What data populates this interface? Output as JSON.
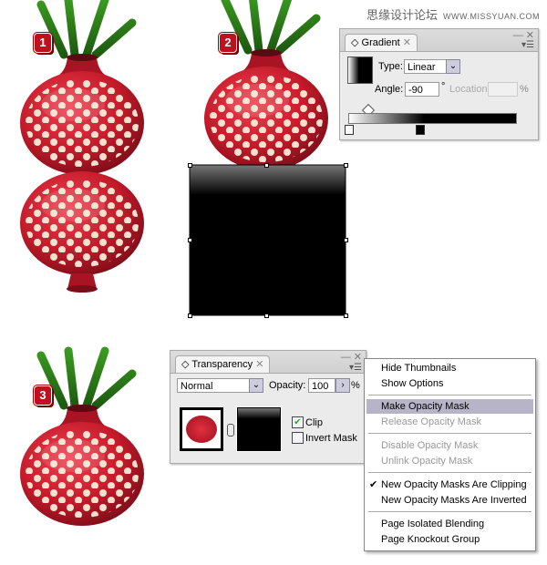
{
  "watermark": {
    "cn": "思缘设计论坛",
    "url": "WWW.MISSYUAN.COM"
  },
  "steps": [
    "1",
    "2",
    "3"
  ],
  "gradient_panel": {
    "tab": "Gradient",
    "type_label": "Type:",
    "type_value": "Linear",
    "angle_label": "Angle:",
    "angle_value": "-90",
    "degree": "°",
    "location_label": "Location:",
    "location_value": "",
    "percent": "%"
  },
  "transparency_panel": {
    "tab": "Transparency",
    "blend_mode": "Normal",
    "opacity_label": "Opacity:",
    "opacity_value": "100",
    "percent": "%",
    "clip_label": "Clip",
    "clip_checked": true,
    "invert_label": "Invert Mask",
    "invert_checked": false
  },
  "menu": {
    "items": [
      {
        "label": "Hide Thumbnails",
        "enabled": true
      },
      {
        "label": "Show Options",
        "enabled": true
      },
      {
        "label": "Make Opacity Mask",
        "enabled": true,
        "highlighted": true
      },
      {
        "label": "Release Opacity Mask",
        "enabled": false
      },
      {
        "label": "Disable Opacity Mask",
        "enabled": false
      },
      {
        "label": "Unlink Opacity Mask",
        "enabled": false
      },
      {
        "label": "New Opacity Masks Are Clipping",
        "enabled": true,
        "checked": true
      },
      {
        "label": "New Opacity Masks Are Inverted",
        "enabled": true
      },
      {
        "label": "Page Isolated Blending",
        "enabled": true
      },
      {
        "label": "Page Knockout Group",
        "enabled": true
      }
    ]
  },
  "colors": {
    "pomegranate": "#c41a2a",
    "highlight": "#b8b4c8",
    "dots": "#f6ecd8"
  }
}
